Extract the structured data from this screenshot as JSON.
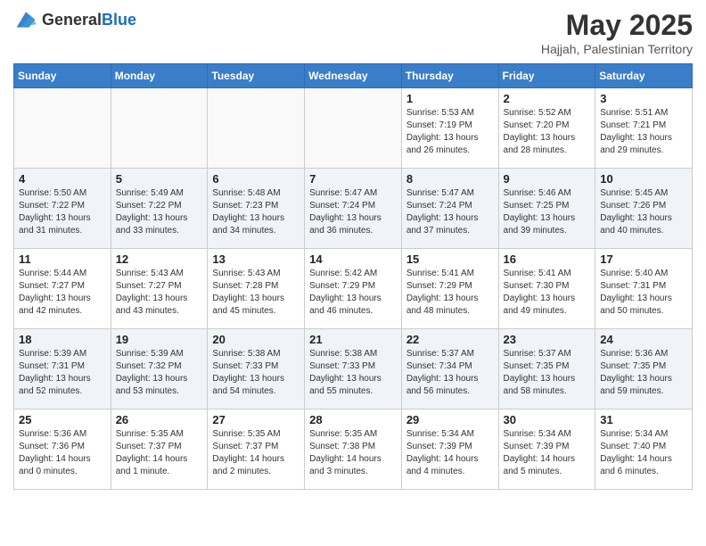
{
  "logo": {
    "general": "General",
    "blue": "Blue"
  },
  "title": {
    "month_year": "May 2025",
    "location": "Hajjah, Palestinian Territory"
  },
  "weekdays": [
    "Sunday",
    "Monday",
    "Tuesday",
    "Wednesday",
    "Thursday",
    "Friday",
    "Saturday"
  ],
  "weeks": [
    [
      {
        "day": "",
        "info": ""
      },
      {
        "day": "",
        "info": ""
      },
      {
        "day": "",
        "info": ""
      },
      {
        "day": "",
        "info": ""
      },
      {
        "day": "1",
        "info": "Sunrise: 5:53 AM\nSunset: 7:19 PM\nDaylight: 13 hours and 26 minutes."
      },
      {
        "day": "2",
        "info": "Sunrise: 5:52 AM\nSunset: 7:20 PM\nDaylight: 13 hours and 28 minutes."
      },
      {
        "day": "3",
        "info": "Sunrise: 5:51 AM\nSunset: 7:21 PM\nDaylight: 13 hours and 29 minutes."
      }
    ],
    [
      {
        "day": "4",
        "info": "Sunrise: 5:50 AM\nSunset: 7:22 PM\nDaylight: 13 hours and 31 minutes."
      },
      {
        "day": "5",
        "info": "Sunrise: 5:49 AM\nSunset: 7:22 PM\nDaylight: 13 hours and 33 minutes."
      },
      {
        "day": "6",
        "info": "Sunrise: 5:48 AM\nSunset: 7:23 PM\nDaylight: 13 hours and 34 minutes."
      },
      {
        "day": "7",
        "info": "Sunrise: 5:47 AM\nSunset: 7:24 PM\nDaylight: 13 hours and 36 minutes."
      },
      {
        "day": "8",
        "info": "Sunrise: 5:47 AM\nSunset: 7:24 PM\nDaylight: 13 hours and 37 minutes."
      },
      {
        "day": "9",
        "info": "Sunrise: 5:46 AM\nSunset: 7:25 PM\nDaylight: 13 hours and 39 minutes."
      },
      {
        "day": "10",
        "info": "Sunrise: 5:45 AM\nSunset: 7:26 PM\nDaylight: 13 hours and 40 minutes."
      }
    ],
    [
      {
        "day": "11",
        "info": "Sunrise: 5:44 AM\nSunset: 7:27 PM\nDaylight: 13 hours and 42 minutes."
      },
      {
        "day": "12",
        "info": "Sunrise: 5:43 AM\nSunset: 7:27 PM\nDaylight: 13 hours and 43 minutes."
      },
      {
        "day": "13",
        "info": "Sunrise: 5:43 AM\nSunset: 7:28 PM\nDaylight: 13 hours and 45 minutes."
      },
      {
        "day": "14",
        "info": "Sunrise: 5:42 AM\nSunset: 7:29 PM\nDaylight: 13 hours and 46 minutes."
      },
      {
        "day": "15",
        "info": "Sunrise: 5:41 AM\nSunset: 7:29 PM\nDaylight: 13 hours and 48 minutes."
      },
      {
        "day": "16",
        "info": "Sunrise: 5:41 AM\nSunset: 7:30 PM\nDaylight: 13 hours and 49 minutes."
      },
      {
        "day": "17",
        "info": "Sunrise: 5:40 AM\nSunset: 7:31 PM\nDaylight: 13 hours and 50 minutes."
      }
    ],
    [
      {
        "day": "18",
        "info": "Sunrise: 5:39 AM\nSunset: 7:31 PM\nDaylight: 13 hours and 52 minutes."
      },
      {
        "day": "19",
        "info": "Sunrise: 5:39 AM\nSunset: 7:32 PM\nDaylight: 13 hours and 53 minutes."
      },
      {
        "day": "20",
        "info": "Sunrise: 5:38 AM\nSunset: 7:33 PM\nDaylight: 13 hours and 54 minutes."
      },
      {
        "day": "21",
        "info": "Sunrise: 5:38 AM\nSunset: 7:33 PM\nDaylight: 13 hours and 55 minutes."
      },
      {
        "day": "22",
        "info": "Sunrise: 5:37 AM\nSunset: 7:34 PM\nDaylight: 13 hours and 56 minutes."
      },
      {
        "day": "23",
        "info": "Sunrise: 5:37 AM\nSunset: 7:35 PM\nDaylight: 13 hours and 58 minutes."
      },
      {
        "day": "24",
        "info": "Sunrise: 5:36 AM\nSunset: 7:35 PM\nDaylight: 13 hours and 59 minutes."
      }
    ],
    [
      {
        "day": "25",
        "info": "Sunrise: 5:36 AM\nSunset: 7:36 PM\nDaylight: 14 hours and 0 minutes."
      },
      {
        "day": "26",
        "info": "Sunrise: 5:35 AM\nSunset: 7:37 PM\nDaylight: 14 hours and 1 minute."
      },
      {
        "day": "27",
        "info": "Sunrise: 5:35 AM\nSunset: 7:37 PM\nDaylight: 14 hours and 2 minutes."
      },
      {
        "day": "28",
        "info": "Sunrise: 5:35 AM\nSunset: 7:38 PM\nDaylight: 14 hours and 3 minutes."
      },
      {
        "day": "29",
        "info": "Sunrise: 5:34 AM\nSunset: 7:39 PM\nDaylight: 14 hours and 4 minutes."
      },
      {
        "day": "30",
        "info": "Sunrise: 5:34 AM\nSunset: 7:39 PM\nDaylight: 14 hours and 5 minutes."
      },
      {
        "day": "31",
        "info": "Sunrise: 5:34 AM\nSunset: 7:40 PM\nDaylight: 14 hours and 6 minutes."
      }
    ]
  ]
}
